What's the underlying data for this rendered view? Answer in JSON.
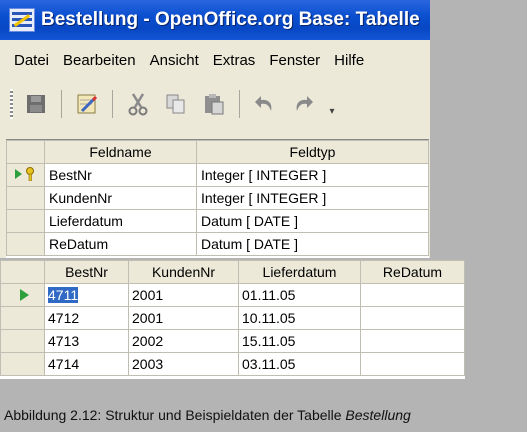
{
  "window": {
    "title": "Bestellung - OpenOffice.org Base: Tabelle",
    "menu": [
      "Datei",
      "Bearbeiten",
      "Ansicht",
      "Extras",
      "Fenster",
      "Hilfe"
    ]
  },
  "toolbar": {
    "icons": [
      "save-icon",
      "edit-icon",
      "cut-icon",
      "copy-icon",
      "paste-icon",
      "undo-icon",
      "redo-icon"
    ]
  },
  "design": {
    "headers": {
      "name": "Feldname",
      "type": "Feldtyp"
    },
    "rows": [
      {
        "name": "BestNr",
        "type": "Integer [ INTEGER ]",
        "primary_key": true
      },
      {
        "name": "KundenNr",
        "type": "Integer [ INTEGER ]"
      },
      {
        "name": "Lieferdatum",
        "type": "Datum [ DATE ]"
      },
      {
        "name": "ReDatum",
        "type": "Datum [ DATE ]"
      }
    ]
  },
  "data": {
    "headers": [
      "BestNr",
      "KundenNr",
      "Lieferdatum",
      "ReDatum"
    ],
    "rows": [
      [
        "4711",
        "2001",
        "01.11.05",
        ""
      ],
      [
        "4712",
        "2001",
        "10.11.05",
        ""
      ],
      [
        "4713",
        "2002",
        "15.11.05",
        ""
      ],
      [
        "4714",
        "2003",
        "03.11.05",
        ""
      ]
    ]
  },
  "caption": {
    "text": "Abbildung 2.12: Struktur und Beispieldaten der Tabelle",
    "emphasis": "Bestellung"
  }
}
